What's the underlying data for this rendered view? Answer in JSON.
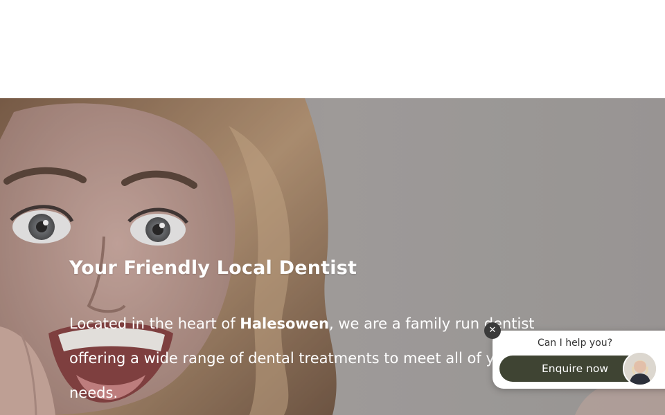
{
  "hero": {
    "title": "Your Friendly Local Dentist",
    "text_before": "Located in the heart of ",
    "text_bold": "Halesowen",
    "text_after": ", we are a family run dentist offering a wide range of dental treatments to meet all of your needs."
  },
  "chat": {
    "close_symbol": "✕",
    "prompt": "Can I help you?",
    "button_label": "Enquire now"
  },
  "colors": {
    "hero_overlay": "#9b9898",
    "chat_button": "#3f4433",
    "text_on_hero": "#ffffff"
  },
  "icons": {
    "close": "close-icon",
    "avatar": "agent-avatar"
  }
}
